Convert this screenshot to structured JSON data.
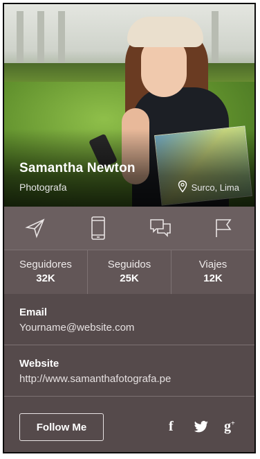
{
  "profile": {
    "name": "Samantha Newton",
    "role": "Photografa",
    "location": "Surco, Lima"
  },
  "actions": [
    {
      "icon": "send-icon"
    },
    {
      "icon": "phone-icon"
    },
    {
      "icon": "chat-icon"
    },
    {
      "icon": "flag-icon"
    }
  ],
  "stats": [
    {
      "label": "Seguidores",
      "value": "32K"
    },
    {
      "label": "Seguidos",
      "value": "25K"
    },
    {
      "label": "Viajes",
      "value": "12K"
    }
  ],
  "contact": {
    "email_label": "Email",
    "email_value": "Yourname@website.com",
    "website_label": "Website",
    "website_value": "http://www.samanthafotografa.pe"
  },
  "footer": {
    "follow_label": "Follow Me",
    "social": [
      "facebook-icon",
      "twitter-icon",
      "google-plus-icon"
    ],
    "facebook_glyph": "f",
    "google_glyph": "g"
  },
  "colors": {
    "panel": "#554a4b",
    "icon_row": "#6b5f60",
    "stats_row": "#625657",
    "text": "#ffffff"
  }
}
